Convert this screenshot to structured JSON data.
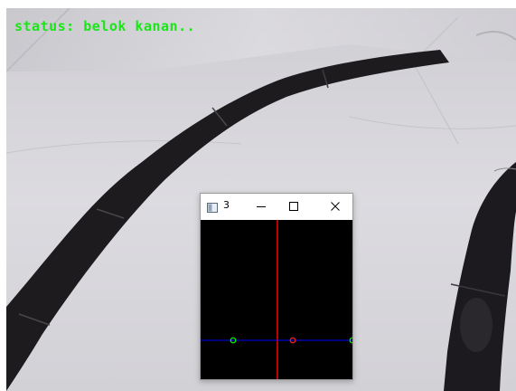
{
  "overlay": {
    "status_text": "status: belok kanan..",
    "status_color": "#19e619"
  },
  "window": {
    "title": "3",
    "app_icon": "window-app-icon",
    "buttons": {
      "minimize_icon": "minimize-icon",
      "maximize_icon": "maximize-icon",
      "close_icon": "close-icon"
    }
  },
  "canvas": {
    "background": "#000000",
    "vertical_line_color": "#ff0000",
    "horizontal_line_color": "#0000ff",
    "markers": [
      {
        "name": "left-point-marker",
        "color": "#00ff00"
      },
      {
        "name": "center-point-marker",
        "color": "#ff0000"
      },
      {
        "name": "right-point-marker",
        "color": "#00ff00"
      }
    ]
  },
  "colors": {
    "floor": "#d7d6da",
    "tape": "#1e1b1f"
  }
}
